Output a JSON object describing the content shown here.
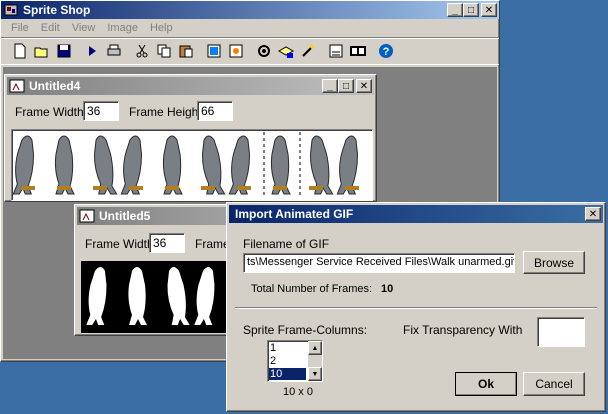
{
  "app": {
    "title": "Sprite Shop",
    "menu": [
      "File",
      "Edit",
      "View",
      "Image",
      "Help"
    ],
    "toolbar_icons": [
      "new-icon",
      "open-icon",
      "save-icon",
      "play-icon",
      "print-icon",
      "cut-icon",
      "copy-icon",
      "paste-icon",
      "image-icon",
      "refresh-icon",
      "settings-icon",
      "layers-icon",
      "wand-icon",
      "frame-icon",
      "filmstrip-icon",
      "help-icon"
    ]
  },
  "child1": {
    "title": "Untitled4",
    "frame_width_label": "Frame Width",
    "frame_width": "36",
    "frame_height_label": "Frame Height",
    "frame_height": "66"
  },
  "child2": {
    "title": "Untitled5",
    "frame_width_label": "Frame Width",
    "frame_width": "36",
    "frame_height_label_partial": "Frame"
  },
  "dialog": {
    "title": "Import Animated GIF",
    "filename_label": "Filename of GIF",
    "filename_value": "ts\\Messenger Service Received Files\\Walk unarmed.gif",
    "browse_label": "Browse",
    "total_frames_label": "Total Number of Frames:",
    "total_frames_value": "10",
    "columns_label": "Sprite Frame-Columns:",
    "columns_options": [
      "1",
      "2",
      "10"
    ],
    "columns_selected": "10",
    "grid_readout": "10 x 0",
    "transparency_label": "Fix Transparency With",
    "transparency_color": "#ffffff",
    "ok_label": "Ok",
    "cancel_label": "Cancel"
  }
}
